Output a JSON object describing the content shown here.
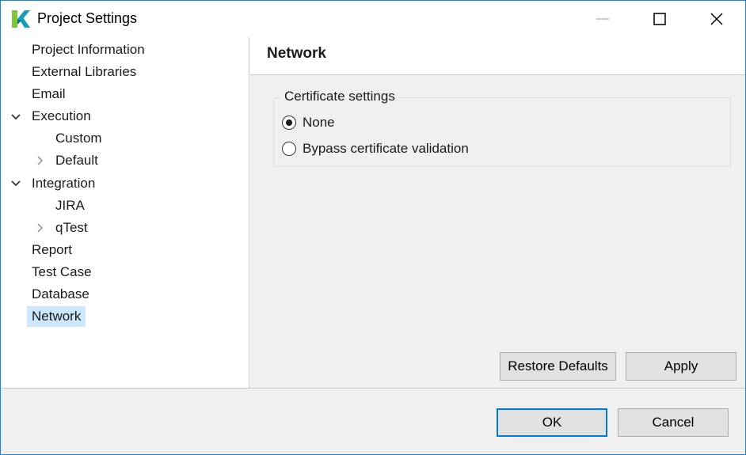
{
  "window": {
    "title": "Project Settings",
    "icon": "katalon-k-logo",
    "controls": {
      "minimize": "minimize-icon",
      "maximize": "maximize-icon",
      "close": "close-icon"
    }
  },
  "sidebar": {
    "items": [
      {
        "label": "Project Information",
        "level": 0,
        "twisty": "none"
      },
      {
        "label": "External Libraries",
        "level": 0,
        "twisty": "none"
      },
      {
        "label": "Email",
        "level": 0,
        "twisty": "none"
      },
      {
        "label": "Execution",
        "level": 0,
        "twisty": "expanded"
      },
      {
        "label": "Custom",
        "level": 1,
        "twisty": "none"
      },
      {
        "label": "Default",
        "level": 1,
        "twisty": "collapsed"
      },
      {
        "label": "Integration",
        "level": 0,
        "twisty": "expanded"
      },
      {
        "label": "JIRA",
        "level": 1,
        "twisty": "none"
      },
      {
        "label": "qTest",
        "level": 1,
        "twisty": "collapsed"
      },
      {
        "label": "Report",
        "level": 0,
        "twisty": "none"
      },
      {
        "label": "Test Case",
        "level": 0,
        "twisty": "none"
      },
      {
        "label": "Database",
        "level": 0,
        "twisty": "none"
      },
      {
        "label": "Network",
        "level": 0,
        "twisty": "none",
        "selected": true
      }
    ]
  },
  "panel": {
    "title": "Network",
    "certificate_group": {
      "legend": "Certificate settings",
      "options": [
        {
          "label": "None",
          "checked": true
        },
        {
          "label": "Bypass certificate validation",
          "checked": false
        }
      ]
    },
    "restore_defaults_label": "Restore Defaults",
    "apply_label": "Apply"
  },
  "footer": {
    "ok_label": "OK",
    "cancel_label": "Cancel"
  },
  "colors": {
    "window_border": "#1883d7",
    "selection": "#cce8ff",
    "panel_background": "#f0f0f0",
    "default_button_border": "#0078d7",
    "logo_green": "#7ec63f",
    "logo_teal": "#16a0b8"
  }
}
